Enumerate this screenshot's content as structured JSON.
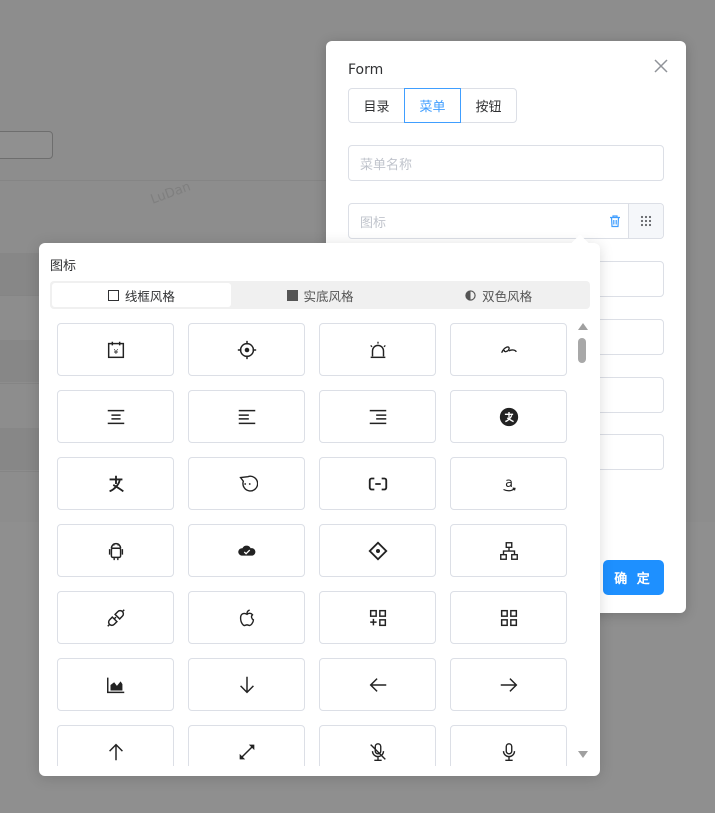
{
  "background": {
    "watermark": "LuDan"
  },
  "dialog": {
    "title": "Form",
    "segments": [
      {
        "label": "目录",
        "active": false
      },
      {
        "label": "菜单",
        "active": true
      },
      {
        "label": "按钮",
        "active": false
      }
    ],
    "menu_name_placeholder": "菜单名称",
    "icon_placeholder": "图标",
    "confirm_label": "确 定"
  },
  "picker": {
    "title": "图标",
    "tabs": [
      {
        "label": "线框风格",
        "active": true,
        "icon": "outline-square-icon"
      },
      {
        "label": "实底风格",
        "active": false,
        "icon": "filled-square-icon"
      },
      {
        "label": "双色风格",
        "active": false,
        "icon": "half-circle-icon"
      }
    ],
    "icons": [
      "account-book-icon",
      "aim-icon",
      "alert-icon",
      "alibaba-icon",
      "align-center-icon",
      "align-left-icon",
      "align-right-icon",
      "alipay-circle-icon",
      "alipay-icon",
      "aliwangwang-icon",
      "aliyun-icon",
      "amazon-icon",
      "android-icon",
      "ant-cloud-icon",
      "ant-design-icon",
      "apartment-icon",
      "api-icon",
      "apple-icon",
      "appstore-add-icon",
      "appstore-icon",
      "area-chart-icon",
      "arrow-down-icon",
      "arrow-left-icon",
      "arrow-right-icon",
      "arrow-up-icon",
      "arrows-alt-icon",
      "audio-muted-icon",
      "audio-icon"
    ]
  },
  "colors": {
    "primary": "#409eff",
    "confirm": "#1e90ff",
    "border": "#dcdfe6",
    "placeholder": "#c0c4cc",
    "text": "#303133"
  }
}
